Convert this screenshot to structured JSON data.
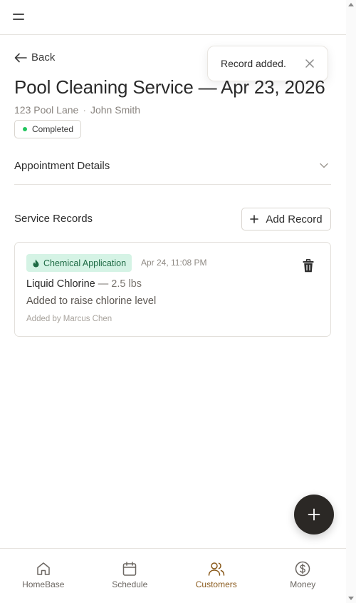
{
  "header": {
    "menu_icon": "hamburger-menu-icon"
  },
  "nav": {
    "back_label": "Back",
    "back_icon": "arrow-left-icon"
  },
  "toast": {
    "message": "Record added.",
    "close_icon": "close-icon"
  },
  "appointment": {
    "title": "Pool Cleaning Service — Apr 23, 2026",
    "address": "123 Pool Lane",
    "separator": "·",
    "customer": "John Smith",
    "status": "Completed",
    "status_color": "#22c55e"
  },
  "details": {
    "label": "Appointment Details",
    "icon": "chevron-down-icon"
  },
  "service_records": {
    "label": "Service Records",
    "add_label": "Add Record",
    "add_icon": "plus-icon",
    "records": [
      {
        "tag": "Chemical Application",
        "tag_icon": "flame-icon",
        "tag_bg": "#d5f3e5",
        "tag_color": "#1f6b45",
        "timestamp": "Apr 24, 11:08 PM",
        "name": "Liquid Chlorine",
        "quantity": "— 2.5 lbs",
        "note": "Added to raise chlorine level",
        "author": "Added by Marcus Chen",
        "delete_icon": "trash-icon"
      }
    ]
  },
  "fab": {
    "icon": "plus-icon"
  },
  "bottom_nav": {
    "active_color": "#8a5a1c",
    "items": [
      {
        "label": "HomeBase",
        "icon": "home-icon"
      },
      {
        "label": "Schedule",
        "icon": "calendar-icon"
      },
      {
        "label": "Customers",
        "icon": "users-icon",
        "active": true
      },
      {
        "label": "Money",
        "icon": "dollar-icon"
      }
    ]
  }
}
